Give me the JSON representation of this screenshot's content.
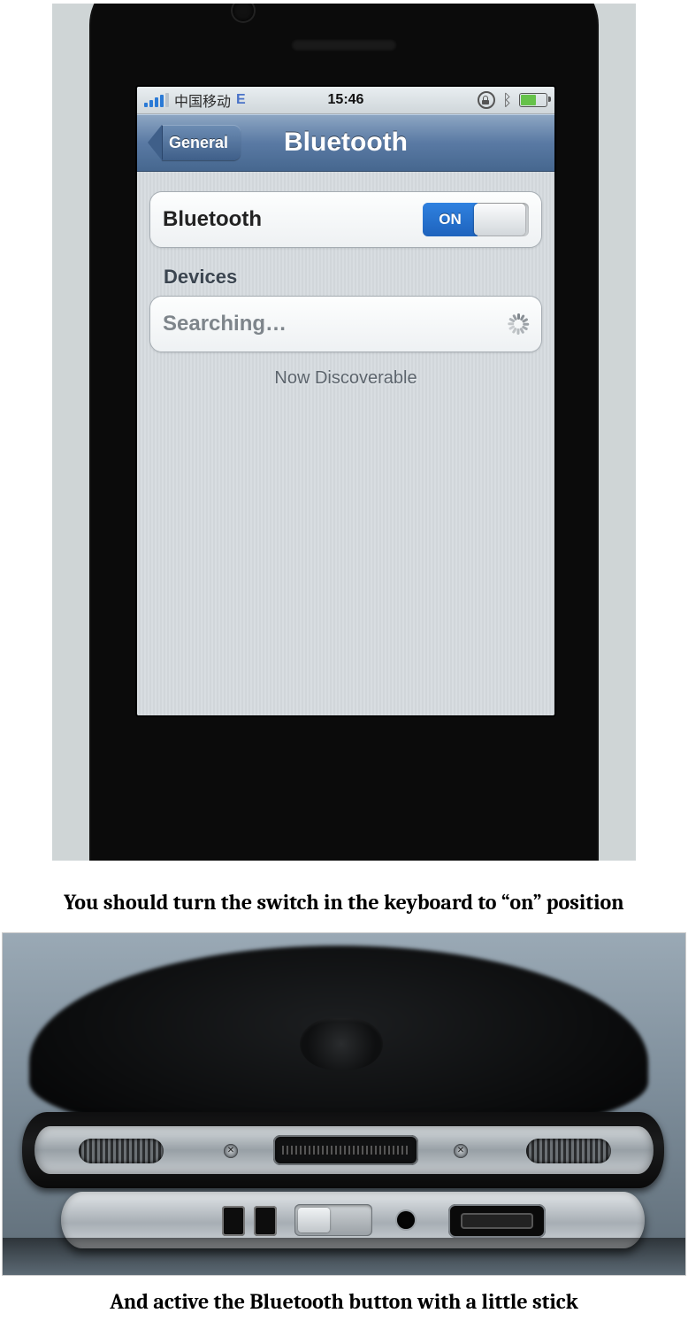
{
  "captions": {
    "first": "You should turn the switch in the keyboard to “on” position",
    "second": "And active the Bluetooth button with a little stick"
  },
  "phone_ui": {
    "status": {
      "carrier": "中国移动",
      "network": "E",
      "time": "15:46"
    },
    "nav": {
      "back": "General",
      "title": "Bluetooth"
    },
    "bluetooth_row": {
      "label": "Bluetooth",
      "switch_text": "ON"
    },
    "devices_header": "Devices",
    "searching": "Searching…",
    "discoverable": "Now Discoverable"
  }
}
